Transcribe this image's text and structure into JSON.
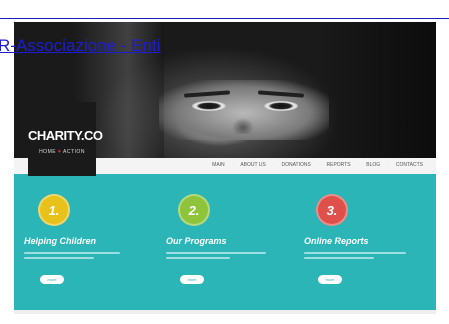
{
  "link": {
    "text": "R-Associazione - Enti"
  },
  "logo": {
    "name": "CHARITY.CO",
    "tagline_pre": "HOME ",
    "tagline_mid": "♥",
    "tagline_post": " ACTION"
  },
  "nav": {
    "items": [
      "MAIN",
      "ABOUT US",
      "DONATIONS",
      "REPORTS",
      "BLOG",
      "CONTACTS"
    ]
  },
  "columns": [
    {
      "number": "1.",
      "title": "Helping Children",
      "badge_color": "#e8c21a",
      "button": "more"
    },
    {
      "number": "2.",
      "title": "Our Programs",
      "badge_color": "#8fc43a",
      "button": "more"
    },
    {
      "number": "3.",
      "title": "Online Reports",
      "badge_color": "#e0504a",
      "button": "more"
    }
  ],
  "colors": {
    "teal": "#2bb5b6",
    "link": "#1d1dd6"
  }
}
